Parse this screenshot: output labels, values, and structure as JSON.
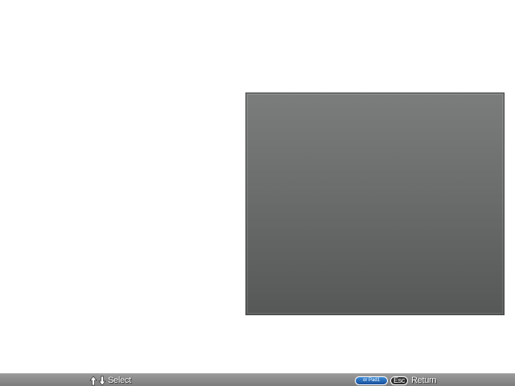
{
  "footer": {
    "select_label": "Select",
    "keypad_key_label": "or Pad1",
    "esc_key_label": "Esc",
    "return_label": "Return"
  },
  "icons": {
    "up": "arrow-up-icon",
    "down": "arrow-down-icon"
  },
  "colors": {
    "preview_top": "#7b7d7c",
    "preview_bottom": "#565858",
    "footer_bar": "#8a8a8a",
    "keypad_pill": "#2a6cc0"
  }
}
